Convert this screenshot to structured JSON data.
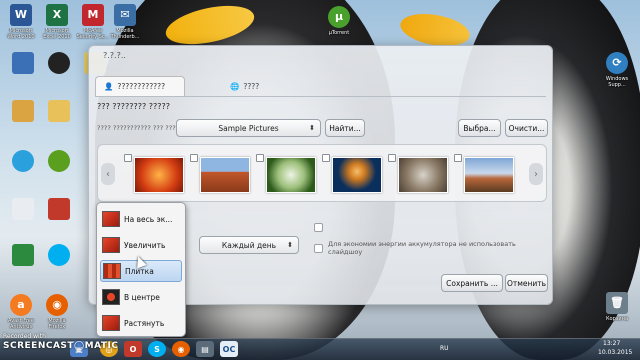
{
  "desktop": {
    "icons": [
      {
        "label": "Microsoft Word 2010",
        "glyph": "W",
        "color": "#2b5797"
      },
      {
        "label": "Microsoft Excel 2010",
        "glyph": "X",
        "color": "#1f7244"
      },
      {
        "label": "McAfee Security Sc...",
        "glyph": "M",
        "color": "#c1272d"
      },
      {
        "label": "Mozilla Thunderb...",
        "glyph": "✉",
        "color": "#3a6ea5"
      },
      {
        "label": "µTorrent",
        "glyph": "µ",
        "color": "#4aa02c"
      },
      {
        "label": "Windows Supp...",
        "glyph": "⟳",
        "color": "#2f7fc1"
      },
      {
        "label": "Корзина",
        "glyph": "🗑",
        "color": "#6e7f8c"
      },
      {
        "label": "Avast Free Antivirus",
        "glyph": "a",
        "color": "#f47b20"
      },
      {
        "label": "Mozilla Firefox",
        "glyph": "◉",
        "color": "#e66000"
      }
    ]
  },
  "dialog": {
    "title": "?.?.?..",
    "tabs": [
      {
        "label": "????????????",
        "icon": "user-icon"
      },
      {
        "label": "????",
        "icon": "globe-icon"
      }
    ],
    "heading": "??? ???????? ?????",
    "subtitle": "???? ??????????? ??? ????? ????? ??????????",
    "folder_select": "Sample Pictures",
    "find_button": "Найти...",
    "choose_button": "Выбра...",
    "clear_button": "Очисти...",
    "interval_select": "Каждый день",
    "battery_option": "Для экономии энергии аккумулятора не использовать слайдшоу",
    "save_button": "Сохранить ...",
    "cancel_button": "Отменить"
  },
  "thumbnails": [
    {
      "name": "chrysanthemum",
      "colors": [
        "#ff9a2e",
        "#c62a10"
      ]
    },
    {
      "name": "desert",
      "colors": [
        "#8fb6e0",
        "#c2572b"
      ]
    },
    {
      "name": "hydrangeas",
      "colors": [
        "#2c5a1a",
        "#d9e6c9"
      ]
    },
    {
      "name": "jellyfish",
      "colors": [
        "#0b2f5c",
        "#f0a040"
      ]
    },
    {
      "name": "koala",
      "colors": [
        "#6b5a46",
        "#cfc7bc"
      ]
    },
    {
      "name": "lighthouse",
      "colors": [
        "#7fa6d6",
        "#b8673a"
      ]
    }
  ],
  "menu": {
    "items": [
      {
        "label": "На весь эк..."
      },
      {
        "label": "Увеличить"
      },
      {
        "label": "Плитка"
      },
      {
        "label": "В центре"
      },
      {
        "label": "Растянуть"
      }
    ],
    "selected_index": 2
  },
  "watermark": {
    "small": "Recorded with",
    "big": "SCREENCAST◯MATIC"
  },
  "taskbar": {
    "lang": "RU",
    "time": "13:27",
    "date": "10.03.2015"
  }
}
